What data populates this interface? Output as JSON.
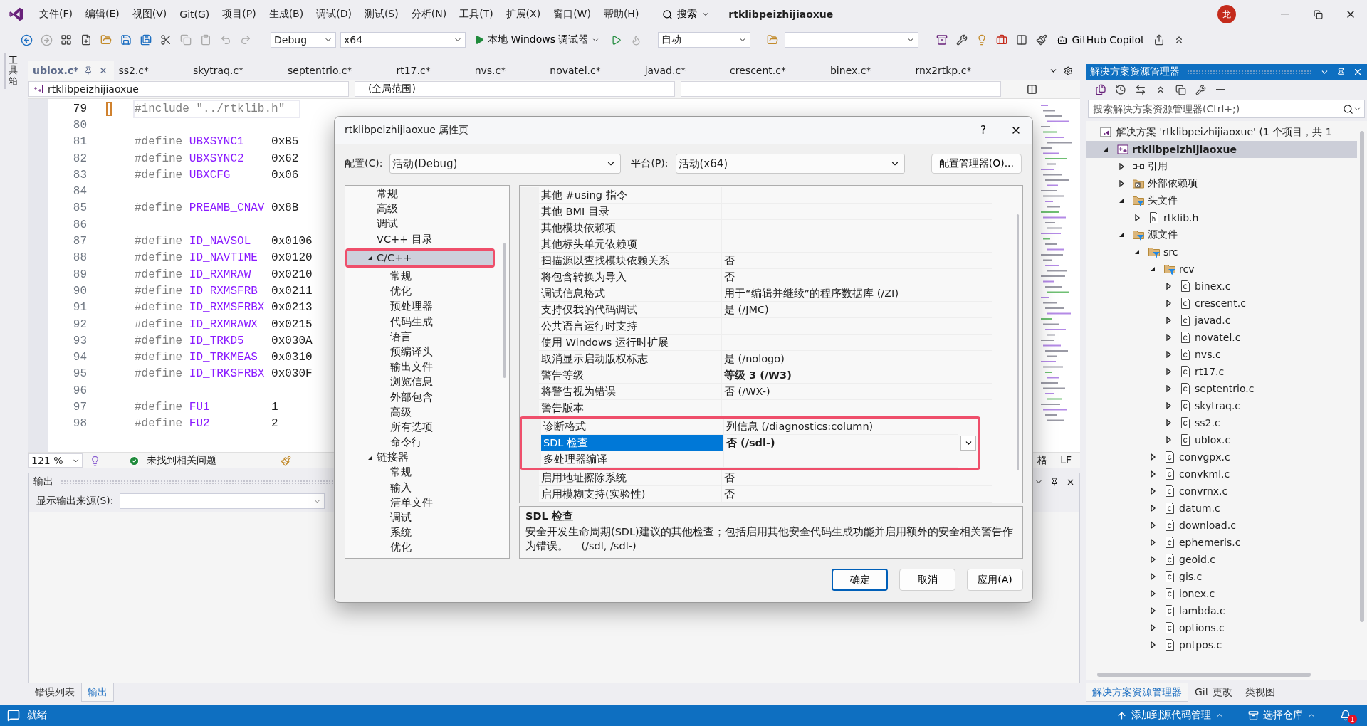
{
  "menu_bar": {
    "items": [
      "文件(F)",
      "编辑(E)",
      "视图(V)",
      "Git(G)",
      "项目(P)",
      "生成(B)",
      "调试(D)",
      "测试(S)",
      "分析(N)",
      "工具(T)",
      "扩展(X)",
      "窗口(W)",
      "帮助(H)"
    ],
    "search": "搜索",
    "title": "rtklibpeizhijiaoxue",
    "avatar": "龙"
  },
  "toolbar": {
    "configuration": "Debug",
    "platform": "x64",
    "debugger": "本地 Windows 调试器",
    "run_mode": "自动",
    "copilot": "GitHub Copilot"
  },
  "toolbox_tab": "工具箱",
  "editor": {
    "tabs": [
      {
        "label": "ublox.c*",
        "selected": true
      },
      {
        "label": "ss2.c*",
        "selected": false
      },
      {
        "label": "skytraq.c*",
        "selected": false
      },
      {
        "label": "septentrio.c*",
        "selected": false
      },
      {
        "label": "rt17.c*",
        "selected": false
      },
      {
        "label": "nvs.c*",
        "selected": false
      },
      {
        "label": "novatel.c*",
        "selected": false
      },
      {
        "label": "javad.c*",
        "selected": false
      },
      {
        "label": "crescent.c*",
        "selected": false
      },
      {
        "label": "binex.c*",
        "selected": false
      },
      {
        "label": "rnx2rtkp.c*",
        "selected": false
      }
    ],
    "scope_bar": {
      "project": "rtklibpeizhijiaoxue",
      "scope": "(全局范围)"
    },
    "lines": [
      {
        "number": "79",
        "current": true,
        "kind": "include",
        "text": "#include \"../rtklib.h\""
      },
      {
        "number": "80",
        "current": false,
        "kind": "blank"
      },
      {
        "number": "81",
        "current": false,
        "kind": "define",
        "keyword": "#define",
        "name": "UBXSYNC1",
        "value": "0xB5"
      },
      {
        "number": "82",
        "current": false,
        "kind": "define",
        "keyword": "#define",
        "name": "UBXSYNC2",
        "value": "0x62"
      },
      {
        "number": "83",
        "current": false,
        "kind": "define",
        "keyword": "#define",
        "name": "UBXCFG",
        "value": "0x06"
      },
      {
        "number": "84",
        "current": false,
        "kind": "blank"
      },
      {
        "number": "85",
        "current": false,
        "kind": "define",
        "keyword": "#define",
        "name": "PREAMB_CNAV",
        "value": "0x8B"
      },
      {
        "number": "86",
        "current": false,
        "kind": "blank"
      },
      {
        "number": "87",
        "current": false,
        "kind": "define",
        "keyword": "#define",
        "name": "ID_NAVSOL",
        "value": "0x0106"
      },
      {
        "number": "88",
        "current": false,
        "kind": "define",
        "keyword": "#define",
        "name": "ID_NAVTIME",
        "value": "0x0120"
      },
      {
        "number": "89",
        "current": false,
        "kind": "define",
        "keyword": "#define",
        "name": "ID_RXMRAW",
        "value": "0x0210"
      },
      {
        "number": "90",
        "current": false,
        "kind": "define",
        "keyword": "#define",
        "name": "ID_RXMSFRB",
        "value": "0x0211"
      },
      {
        "number": "91",
        "current": false,
        "kind": "define",
        "keyword": "#define",
        "name": "ID_RXMSFRBX",
        "value": "0x0213"
      },
      {
        "number": "92",
        "current": false,
        "kind": "define",
        "keyword": "#define",
        "name": "ID_RXMRAWX",
        "value": "0x0215"
      },
      {
        "number": "93",
        "current": false,
        "kind": "define",
        "keyword": "#define",
        "name": "ID_TRKD5",
        "value": "0x030A"
      },
      {
        "number": "94",
        "current": false,
        "kind": "define",
        "keyword": "#define",
        "name": "ID_TRKMEAS",
        "value": "0x0310"
      },
      {
        "number": "95",
        "current": false,
        "kind": "define",
        "keyword": "#define",
        "name": "ID_TRKSFRBX",
        "value": "0x030F"
      },
      {
        "number": "96",
        "current": false,
        "kind": "blank"
      },
      {
        "number": "97",
        "current": false,
        "kind": "define",
        "keyword": "#define",
        "name": "FU1",
        "value": "1"
      },
      {
        "number": "98",
        "current": false,
        "kind": "define",
        "keyword": "#define",
        "name": "FU2",
        "value": "2"
      }
    ],
    "status": {
      "zoom": "121 %",
      "issues": "未找到相关问题",
      "indent_fragment": "格",
      "line_ending": "LF"
    }
  },
  "output": {
    "title": "输出",
    "source_label": "显示输出来源(S):"
  },
  "bottom_tabs": [
    {
      "label": "错误列表",
      "selected": false
    },
    {
      "label": "输出",
      "selected": true
    }
  ],
  "dialog": {
    "title": "rtklibpeizhijiaoxue 属性页",
    "help": "?",
    "config_label": "配置(C):",
    "config_value": "活动(Debug)",
    "platform_label": "平台(P):",
    "platform_value": "活动(x64)",
    "config_manager": "配置管理器(O)...",
    "tree": [
      {
        "label": "常规",
        "selected": false,
        "highlighted": false
      },
      {
        "label": "高级",
        "selected": false,
        "highlighted": false
      },
      {
        "label": "调试",
        "selected": false,
        "highlighted": false
      },
      {
        "label": "VC++ 目录",
        "selected": false,
        "highlighted": false
      },
      {
        "label": "C/C++",
        "selected": true,
        "highlighted": true,
        "expanded": true,
        "children": [
          {
            "label": "常规",
            "selected": false
          },
          {
            "label": "优化",
            "selected": false
          },
          {
            "label": "预处理器",
            "selected": false
          },
          {
            "label": "代码生成",
            "selected": false
          },
          {
            "label": "语言",
            "selected": false
          },
          {
            "label": "预编译头",
            "selected": false
          },
          {
            "label": "输出文件",
            "selected": false
          },
          {
            "label": "浏览信息",
            "selected": false
          },
          {
            "label": "外部包含",
            "selected": false
          },
          {
            "label": "高级",
            "selected": false
          },
          {
            "label": "所有选项",
            "selected": false
          },
          {
            "label": "命令行",
            "selected": false
          }
        ]
      },
      {
        "label": "链接器",
        "selected": false,
        "highlighted": false,
        "expanded": true,
        "children": [
          {
            "label": "常规",
            "selected": false
          },
          {
            "label": "输入",
            "selected": false
          },
          {
            "label": "清单文件",
            "selected": false
          },
          {
            "label": "调试",
            "selected": false
          },
          {
            "label": "系统",
            "selected": false
          },
          {
            "label": "优化",
            "selected": false
          }
        ]
      }
    ],
    "properties": [
      {
        "name": "其他 #using 指令",
        "selected": false,
        "highlighted": false
      },
      {
        "name": "其他 BMI 目录",
        "selected": false,
        "highlighted": false
      },
      {
        "name": "其他模块依赖项",
        "selected": false,
        "highlighted": false
      },
      {
        "name": "其他标头单元依赖项",
        "selected": false,
        "highlighted": false
      },
      {
        "name": "扫描源以查找模块依赖关系",
        "value": "否",
        "bold": false,
        "selected": false,
        "highlighted": false
      },
      {
        "name": "将包含转换为导入",
        "value": "否",
        "bold": false,
        "selected": false,
        "highlighted": false
      },
      {
        "name": "调试信息格式",
        "value": "用于“编辑并继续”的程序数据库 (/ZI)",
        "bold": false,
        "selected": false,
        "highlighted": false
      },
      {
        "name": "支持仅我的代码调试",
        "value": "是 (/JMC)",
        "bold": false,
        "selected": false,
        "highlighted": false
      },
      {
        "name": "公共语言运行时支持",
        "selected": false,
        "highlighted": false
      },
      {
        "name": "使用 Windows 运行时扩展",
        "selected": false,
        "highlighted": false
      },
      {
        "name": "取消显示启动版权标志",
        "value": "是 (/nologo)",
        "bold": false,
        "selected": false,
        "highlighted": false
      },
      {
        "name": "警告等级",
        "value": "等级 3 (/W3)",
        "bold": true,
        "selected": false,
        "highlighted": false
      },
      {
        "name": "将警告视为错误",
        "value": "否 (/WX-)",
        "bold": false,
        "selected": false,
        "highlighted": false
      },
      {
        "name": "警告版本",
        "selected": false,
        "highlighted": false
      },
      {
        "name": "诊断格式",
        "value": "列信息 (/diagnostics:column)",
        "bold": false,
        "selected": false,
        "highlighted": true
      },
      {
        "name": "SDL 检查",
        "value": "否 (/sdl-)",
        "bold": true,
        "selected": true,
        "highlighted": true
      },
      {
        "name": "多处理器编译",
        "selected": false,
        "highlighted": true
      },
      {
        "name": "启用地址擦除系统",
        "value": "否",
        "bold": false,
        "selected": false,
        "highlighted": false
      },
      {
        "name": "启用模糊支持(实验性)",
        "value": "否",
        "bold": false,
        "selected": false,
        "highlighted": false
      }
    ],
    "description": {
      "title": "SDL 检查",
      "text": "安全开发生命周期(SDL)建议的其他检查；包括启用其他安全代码生成功能并启用额外的安全相关警告作为错误。    (/sdl, /sdl-)"
    },
    "buttons": [
      {
        "label": "确定",
        "primary": true
      },
      {
        "label": "取消",
        "primary": false
      },
      {
        "label": "应用(A)",
        "primary": false
      }
    ]
  },
  "solution_explorer": {
    "title": "解决方案资源管理器",
    "search_placeholder": "搜索解决方案资源管理器(Ctrl+;)",
    "solution": {
      "label": "解决方案 'rtklibpeizhijiaoxue' (1 个项目，共 1",
      "selected": false
    },
    "tree": [
      {
        "kind": "project",
        "label": "rtklibpeizhijiaoxue",
        "selected": true,
        "expanded": true,
        "children": [
          {
            "kind": "references",
            "label": "引用",
            "selected": false,
            "expanded": false
          },
          {
            "kind": "external",
            "label": "外部依赖项",
            "selected": false,
            "expanded": false
          },
          {
            "kind": "filter",
            "label": "头文件",
            "selected": false,
            "expanded": true,
            "children": [
              {
                "kind": "header",
                "label": "rtklib.h",
                "selected": false,
                "expanded": false
              }
            ]
          },
          {
            "kind": "filter",
            "label": "源文件",
            "selected": false,
            "expanded": true,
            "children": [
              {
                "kind": "filter",
                "label": "src",
                "selected": false,
                "expanded": true,
                "children": [
                  {
                    "kind": "filter",
                    "label": "rcv",
                    "selected": false,
                    "expanded": true,
                    "children": [
                      {
                        "kind": "source",
                        "label": "binex.c",
                        "selected": false,
                        "expanded": false
                      },
                      {
                        "kind": "source",
                        "label": "crescent.c",
                        "selected": false,
                        "expanded": false
                      },
                      {
                        "kind": "source",
                        "label": "javad.c",
                        "selected": false,
                        "expanded": false
                      },
                      {
                        "kind": "source",
                        "label": "novatel.c",
                        "selected": false,
                        "expanded": false
                      },
                      {
                        "kind": "source",
                        "label": "nvs.c",
                        "selected": false,
                        "expanded": false
                      },
                      {
                        "kind": "source",
                        "label": "rt17.c",
                        "selected": false,
                        "expanded": false
                      },
                      {
                        "kind": "source",
                        "label": "septentrio.c",
                        "selected": false,
                        "expanded": false
                      },
                      {
                        "kind": "source",
                        "label": "skytraq.c",
                        "selected": false,
                        "expanded": false
                      },
                      {
                        "kind": "source",
                        "label": "ss2.c",
                        "selected": false,
                        "expanded": false
                      },
                      {
                        "kind": "source",
                        "label": "ublox.c",
                        "selected": false,
                        "expanded": false
                      }
                    ]
                  },
                  {
                    "kind": "source",
                    "label": "convgpx.c",
                    "selected": false,
                    "expanded": false
                  },
                  {
                    "kind": "source",
                    "label": "convkml.c",
                    "selected": false,
                    "expanded": false
                  },
                  {
                    "kind": "source",
                    "label": "convrnx.c",
                    "selected": false,
                    "expanded": false
                  },
                  {
                    "kind": "source",
                    "label": "datum.c",
                    "selected": false,
                    "expanded": false
                  },
                  {
                    "kind": "source",
                    "label": "download.c",
                    "selected": false,
                    "expanded": false
                  },
                  {
                    "kind": "source",
                    "label": "ephemeris.c",
                    "selected": false,
                    "expanded": false
                  },
                  {
                    "kind": "source",
                    "label": "geoid.c",
                    "selected": false,
                    "expanded": false
                  },
                  {
                    "kind": "source",
                    "label": "gis.c",
                    "selected": false,
                    "expanded": false
                  },
                  {
                    "kind": "source",
                    "label": "ionex.c",
                    "selected": false,
                    "expanded": false
                  },
                  {
                    "kind": "source",
                    "label": "lambda.c",
                    "selected": false,
                    "expanded": false
                  },
                  {
                    "kind": "source",
                    "label": "options.c",
                    "selected": false,
                    "expanded": false
                  },
                  {
                    "kind": "source",
                    "label": "pntpos.c",
                    "selected": false,
                    "expanded": false
                  }
                ]
              }
            ]
          }
        ]
      }
    ],
    "tabs": [
      {
        "label": "解决方案资源管理器",
        "selected": true
      },
      {
        "label": "Git 更改",
        "selected": false
      },
      {
        "label": "类视图",
        "selected": false
      }
    ]
  },
  "status_bar": {
    "message": "就绪",
    "source_control": "添加到源代码管理",
    "repository": "选择仓库",
    "notifications": "1"
  }
}
